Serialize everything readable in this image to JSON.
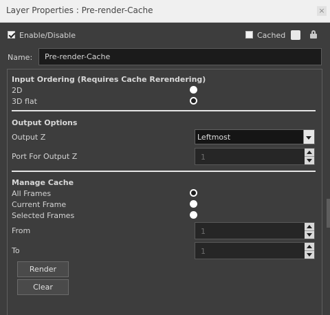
{
  "window": {
    "title": "Layer Properties : Pre-render-Cache",
    "close_glyph": "×"
  },
  "top": {
    "enable_label": "Enable/Disable",
    "enable_checked": true,
    "cached_label": "Cached",
    "cached_checked": false
  },
  "name": {
    "label": "Name:",
    "value": "Pre-render-Cache"
  },
  "input_ordering": {
    "title": "Input Ordering (Requires Cache Rerendering)",
    "options": [
      {
        "label": "2D",
        "selected": false
      },
      {
        "label": "3D flat",
        "selected": true
      }
    ]
  },
  "output_options": {
    "title": "Output Options",
    "output_z_label": "Output Z",
    "output_z_value": "Leftmost",
    "port_label": "Port For Output Z",
    "port_value": "1"
  },
  "manage_cache": {
    "title": "Manage Cache",
    "options": [
      {
        "label": "All Frames",
        "selected": true
      },
      {
        "label": "Current Frame",
        "selected": false
      },
      {
        "label": "Selected Frames",
        "selected": false
      }
    ],
    "from_label": "From",
    "from_value": "1",
    "to_label": "To",
    "to_value": "1",
    "render_label": "Render",
    "clear_label": "Clear"
  }
}
